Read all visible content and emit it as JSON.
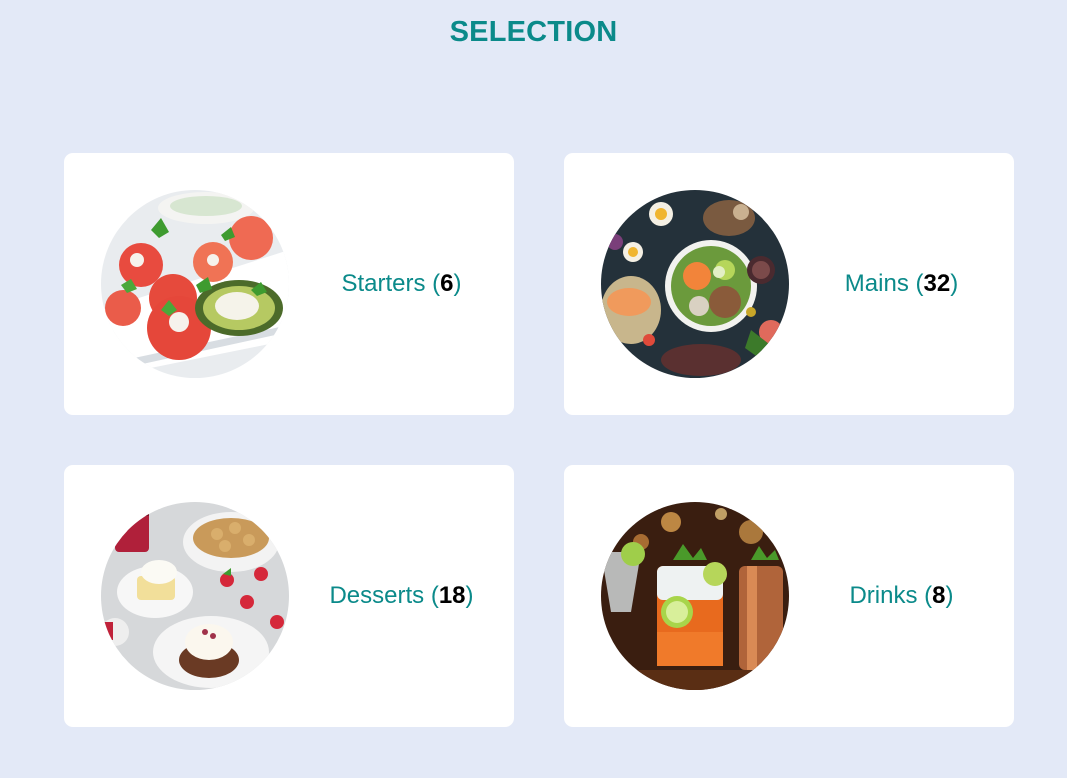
{
  "page": {
    "title": "SELECTION"
  },
  "categories": [
    {
      "name": "Starters",
      "count": "6",
      "image": "starters-food-photo"
    },
    {
      "name": "Mains",
      "count": "32",
      "image": "mains-food-photo"
    },
    {
      "name": "Desserts",
      "count": "18",
      "image": "desserts-food-photo"
    },
    {
      "name": "Drinks",
      "count": "8",
      "image": "drinks-food-photo"
    }
  ],
  "colors": {
    "background": "#e3e9f7",
    "accent": "#0b8a8a",
    "card": "#ffffff",
    "count": "#000000"
  }
}
